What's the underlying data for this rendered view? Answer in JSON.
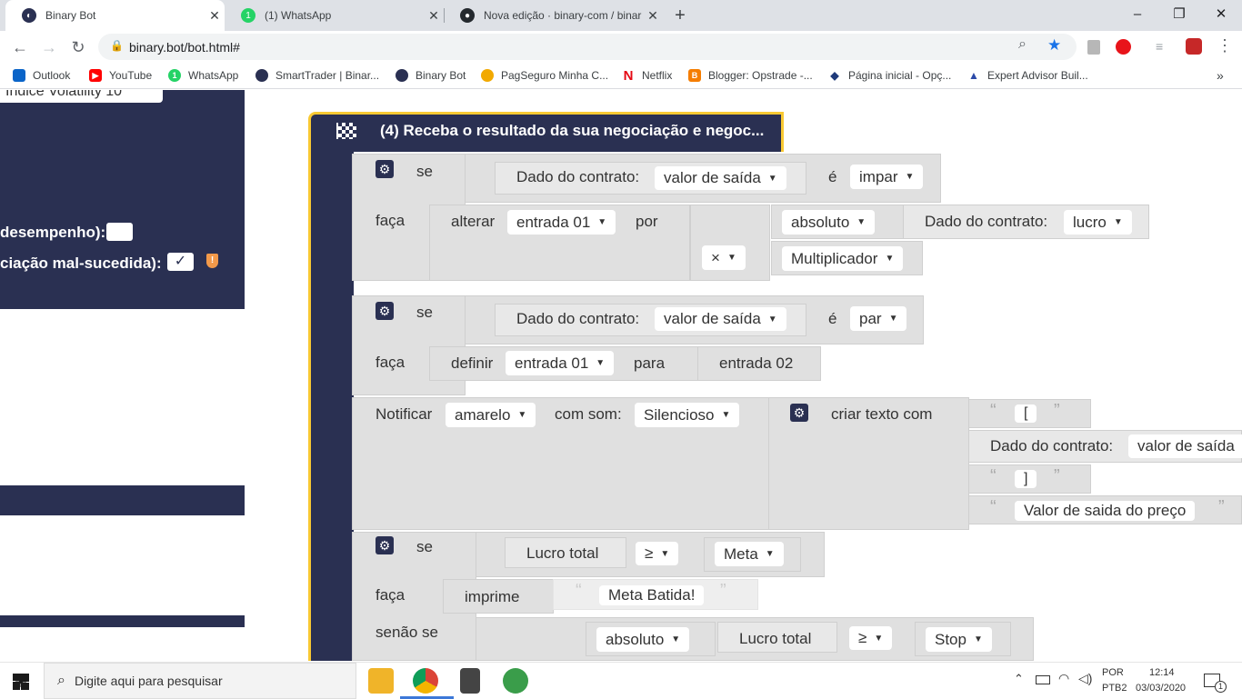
{
  "tabs": [
    {
      "title": "Binary Bot",
      "active": true
    },
    {
      "title": "(1) WhatsApp",
      "active": false
    },
    {
      "title": "Nova edição · binary-com / binar",
      "active": false
    }
  ],
  "new_tab_glyph": "+",
  "window": {
    "minimize": "–",
    "maximize": "❐",
    "close": "✕"
  },
  "address": {
    "url": "binary.bot/bot.html#"
  },
  "bookmarks": [
    {
      "label": "Outlook",
      "color": "#0a64c8"
    },
    {
      "label": "YouTube",
      "color": "#ff0000"
    },
    {
      "label": "WhatsApp",
      "color": "#25d366"
    },
    {
      "label": "SmartTrader | Binar...",
      "color": "#2a3052"
    },
    {
      "label": "Binary Bot",
      "color": "#2a3052"
    },
    {
      "label": "PagSeguro Minha C...",
      "color": "#f2a900"
    },
    {
      "label": "Netflix",
      "color": "#e50914"
    },
    {
      "label": "Blogger: Opstrade -...",
      "color": "#f57d00"
    },
    {
      "label": "Página inicial - Opç...",
      "color": "#1f3a7a"
    },
    {
      "label": "Expert Advisor Buil...",
      "color": "#2b4aa8"
    }
  ],
  "left_panel": {
    "field_value": "Índice Volatility 10",
    "row1_label": "desempenho):",
    "row2_label": "ciação mal-sucedida):",
    "check_mark": "✓"
  },
  "workspace": {
    "header": "(4) Receba o resultado da sua negociação e negoc...",
    "if1": {
      "kw_if": "se",
      "contract_label": "Dado do contrato:",
      "contract_field": "valor de saída",
      "is": "é",
      "parity": "impar",
      "do": "faça",
      "change": "alterar",
      "var": "entrada 01",
      "by": "por",
      "abs": "absoluto",
      "contract_label2": "Dado do contrato:",
      "profit": "lucro",
      "op": "×",
      "multiplier": "Multiplicador"
    },
    "if2": {
      "kw_if": "se",
      "contract_label": "Dado do contrato:",
      "contract_field": "valor de saída",
      "is": "é",
      "parity": "par",
      "do": "faça",
      "set": "definir",
      "var": "entrada 01",
      "to": "para",
      "value": "entrada 02"
    },
    "notify": {
      "label": "Notificar",
      "color": "amarelo",
      "with_sound": "com som:",
      "sound": "Silencioso",
      "create_text": "criar texto com",
      "t1": "[",
      "contract_label": "Dado do contrato:",
      "contract_field": "valor de saída",
      "t2": "]",
      "t3": "Valor de saida do preço"
    },
    "if3": {
      "kw_if": "se",
      "total_profit": "Lucro total",
      "op": "≥",
      "meta": "Meta",
      "do": "faça",
      "print": "imprime",
      "msg": "Meta Batida!",
      "else_if": "senão se",
      "abs": "absoluto",
      "total_profit2": "Lucro total",
      "op2": "≥",
      "stop": "Stop"
    }
  },
  "taskbar": {
    "search_placeholder": "Digite aqui para pesquisar",
    "lang1": "POR",
    "lang2": "PTB2",
    "time": "12:14",
    "date": "03/03/2020",
    "notif_count": "1"
  }
}
